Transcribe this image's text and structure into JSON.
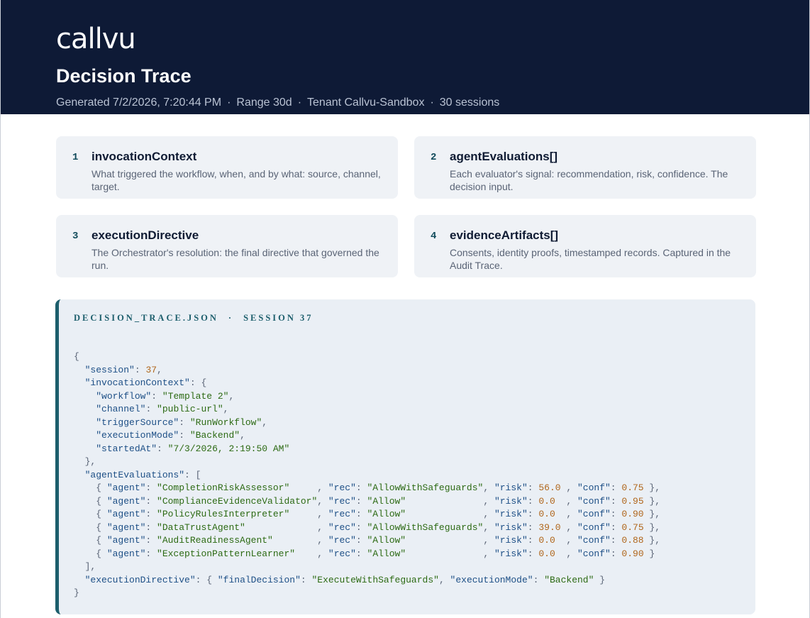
{
  "header": {
    "logo": "callvu",
    "title": "Decision Trace",
    "meta": [
      "Generated 7/2/2026, 7:20:44 PM",
      "Range 30d",
      "Tenant Callvu-Sandbox",
      "30 sessions"
    ],
    "separator": "·"
  },
  "cards": [
    {
      "num": "1",
      "name": "invocationContext",
      "desc": "What triggered the workflow, when, and by what: source, channel, target."
    },
    {
      "num": "2",
      "name": "agentEvaluations[]",
      "desc": "Each evaluator's signal: recommendation, risk, confidence. The decision input."
    },
    {
      "num": "3",
      "name": "executionDirective",
      "desc": "The Orchestrator's resolution: the final directive that governed the run."
    },
    {
      "num": "4",
      "name": "evidenceArtifacts[]",
      "desc": "Consents, identity proofs, timestamped records. Captured in the Audit Trace."
    }
  ],
  "trace": {
    "file_label": "DECISION_TRACE.JSON",
    "session_label": "SESSION 37",
    "separator": "·",
    "session": 37,
    "invocationContext": {
      "workflow": "Template 2",
      "channel": "public-url",
      "triggerSource": "RunWorkflow",
      "executionMode": "Backend",
      "startedAt": "7/3/2026, 2:19:50 AM"
    },
    "agentEvaluations": [
      {
        "agent": "CompletionRiskAssessor",
        "rec": "AllowWithSafeguards",
        "risk": "56.0",
        "conf": "0.75"
      },
      {
        "agent": "ComplianceEvidenceValidator",
        "rec": "Allow",
        "risk": "0.0",
        "conf": "0.95"
      },
      {
        "agent": "PolicyRulesInterpreter",
        "rec": "Allow",
        "risk": "0.0",
        "conf": "0.90"
      },
      {
        "agent": "DataTrustAgent",
        "rec": "AllowWithSafeguards",
        "risk": "39.0",
        "conf": "0.75"
      },
      {
        "agent": "AuditReadinessAgent",
        "rec": "Allow",
        "risk": "0.0",
        "conf": "0.88"
      },
      {
        "agent": "ExceptionPatternLearner",
        "rec": "Allow",
        "risk": "0.0",
        "conf": "0.90"
      }
    ],
    "executionDirective": {
      "finalDecision": "ExecuteWithSafeguards",
      "executionMode": "Backend"
    }
  }
}
